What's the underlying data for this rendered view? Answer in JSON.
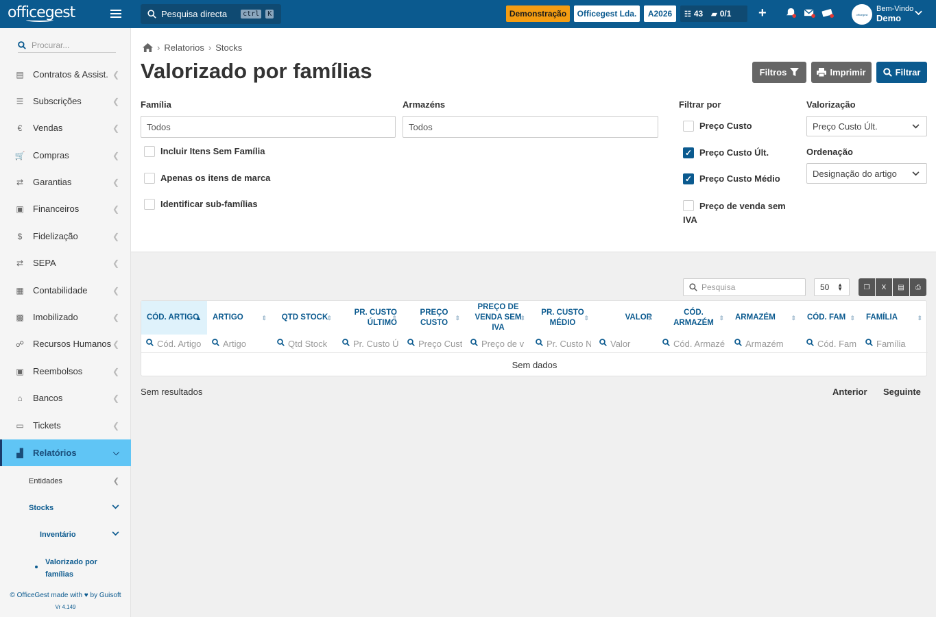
{
  "topbar": {
    "logo": "officegest",
    "search_label": "Pesquisa directa",
    "kbd1": "ctrl",
    "kbd2": "K",
    "demo_label": "Demonstração",
    "company": "Officegest Lda.",
    "year": "A2026",
    "tasks_count": "43",
    "docs_count": "0/1",
    "welcome": "Bem-Vindo",
    "user": "Demo",
    "avatar_text": "officegest"
  },
  "sidebar": {
    "search_placeholder": "Procurar...",
    "items": [
      {
        "label": "Contratos & Assist.",
        "icon": "contract-icon"
      },
      {
        "label": "Subscrições",
        "icon": "list-icon"
      },
      {
        "label": "Vendas",
        "icon": "euro-icon"
      },
      {
        "label": "Compras",
        "icon": "cart-icon"
      },
      {
        "label": "Garantias",
        "icon": "exchange-icon"
      },
      {
        "label": "Financeiros",
        "icon": "money-icon"
      },
      {
        "label": "Fidelização",
        "icon": "hand-coin-icon"
      },
      {
        "label": "SEPA",
        "icon": "exchange-icon"
      },
      {
        "label": "Contabilidade",
        "icon": "calculator-icon"
      },
      {
        "label": "Imobilizado",
        "icon": "box-icon"
      },
      {
        "label": "Recursos Humanos",
        "icon": "org-chart-icon"
      },
      {
        "label": "Reembolsos",
        "icon": "money-icon"
      },
      {
        "label": "Bancos",
        "icon": "bank-icon"
      },
      {
        "label": "Tickets",
        "icon": "ticket-icon"
      },
      {
        "label": "Relatórios",
        "icon": "chart-icon"
      }
    ],
    "sub_entidades": "Entidades",
    "sub_stocks": "Stocks",
    "sub_inventario": "Inventário",
    "sub_valorizado_1": "Valorizado por",
    "sub_valorizado_2": "famílias",
    "footer_1": "© OfficeGest made with ♥ by Guisoft",
    "footer_2": "Vr 4.149"
  },
  "breadcrumb": {
    "level1": "Relatorios",
    "level2": "Stocks"
  },
  "page_title": "Valorizado por famílias",
  "actions": {
    "filtros": "Filtros",
    "imprimir": "Imprimir",
    "filtrar": "Filtrar"
  },
  "form": {
    "familia_label": "Família",
    "familia_placeholder": "Todos",
    "armazens_label": "Armazéns",
    "armazens_placeholder": "Todos",
    "cb_sem_familia": "Incluir Itens Sem Família",
    "cb_marca": "Apenas os itens de marca",
    "cb_subfamilias": "Identificar sub-famílias",
    "filtrar_por_label": "Filtrar por",
    "cb_preco_custo": "Preço Custo",
    "cb_preco_custo_ult": "Preço Custo Últ.",
    "cb_preco_custo_medio": "Preço Custo Médio",
    "cb_preco_venda_1": "Preço de venda sem",
    "cb_preco_venda_2": "IVA",
    "valorizacao_label": "Valorização",
    "valorizacao_value": "Preço Custo Últ.",
    "ordenacao_label": "Ordenação",
    "ordenacao_value": "Designação do artigo"
  },
  "table": {
    "search_placeholder": "Pesquisa",
    "page_size": "50",
    "columns": [
      {
        "h1": "CÓD. ARTIGO",
        "h2": "",
        "filter": "Cód. Artigo"
      },
      {
        "h1": "ARTIGO",
        "h2": "",
        "filter": "Artigo"
      },
      {
        "h1": "QTD STOCK",
        "h2": "",
        "filter": "Qtd Stock"
      },
      {
        "h1": "PR. CUSTO",
        "h2": "ÚLTIMO",
        "filter": "Pr. Custo Ú"
      },
      {
        "h1": "PREÇO CUSTO",
        "h2": "",
        "filter": "Preço Cust"
      },
      {
        "h1": "PREÇO DE",
        "h2": "VENDA SEM IVA",
        "filter": "Preço de v"
      },
      {
        "h1": "PR. CUSTO",
        "h2": "MÉDIO",
        "filter": "Pr. Custo N"
      },
      {
        "h1": "VALOR",
        "h2": "",
        "filter": "Valor"
      },
      {
        "h1": "CÓD. ARMAZÉM",
        "h2": "",
        "filter": "Cód. Armazé"
      },
      {
        "h1": "ARMAZÉM",
        "h2": "",
        "filter": "Armazém"
      },
      {
        "h1": "CÓD. FAM",
        "h2": "",
        "filter": "Cód. Fam"
      },
      {
        "h1": "FAMÍLIA",
        "h2": "",
        "filter": "Família"
      }
    ],
    "empty": "Sem dados",
    "results": "Sem resultados",
    "prev": "Anterior",
    "next": "Seguinte"
  },
  "colors": {
    "brand": "#0b5a8f",
    "active": "#60c5f5",
    "demo": "#f39c12"
  }
}
